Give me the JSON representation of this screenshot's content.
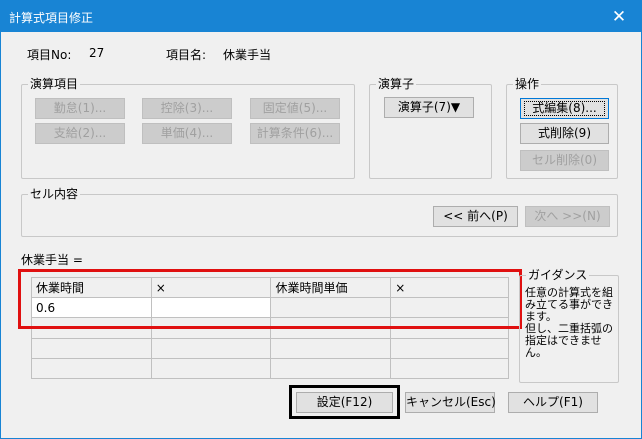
{
  "window": {
    "title": "計算式項目修正",
    "close_glyph": "✕"
  },
  "header": {
    "item_no_label": "項目No:",
    "item_no_value": "27",
    "item_name_label": "項目名:",
    "item_name_value": "休業手当"
  },
  "operand_group": {
    "label": "演算項目",
    "buttons": [
      "勤怠(1)...",
      "控除(3)...",
      "固定値(5)...",
      "支給(2)...",
      "単価(4)...",
      "計算条件(6)..."
    ]
  },
  "operator_group": {
    "label": "演算子",
    "button": "演算子(7)▼"
  },
  "operation_group": {
    "label": "操作",
    "buttons": [
      "式編集(8)...",
      "式削除(9)",
      "セル削除(0)"
    ]
  },
  "cell_group": {
    "label": "セル内容",
    "prev_button": "<< 前へ(P)",
    "next_button": "次へ >>(N)"
  },
  "formula_label": "休業手当 =",
  "grid": {
    "headers": [
      "休業時間",
      "×",
      "休業時間単価",
      "×"
    ],
    "row1": [
      "0.6",
      "",
      "",
      ""
    ]
  },
  "guidance": {
    "label": "ガイダンス",
    "text": "任意の計算式を組み立てる事ができます。\n但し、二重括弧の指定はできません。"
  },
  "footer": {
    "ok_button": "設定(F12)",
    "cancel_button": "キャンセル(Esc)",
    "help_button": "ヘルプ(F1)"
  }
}
